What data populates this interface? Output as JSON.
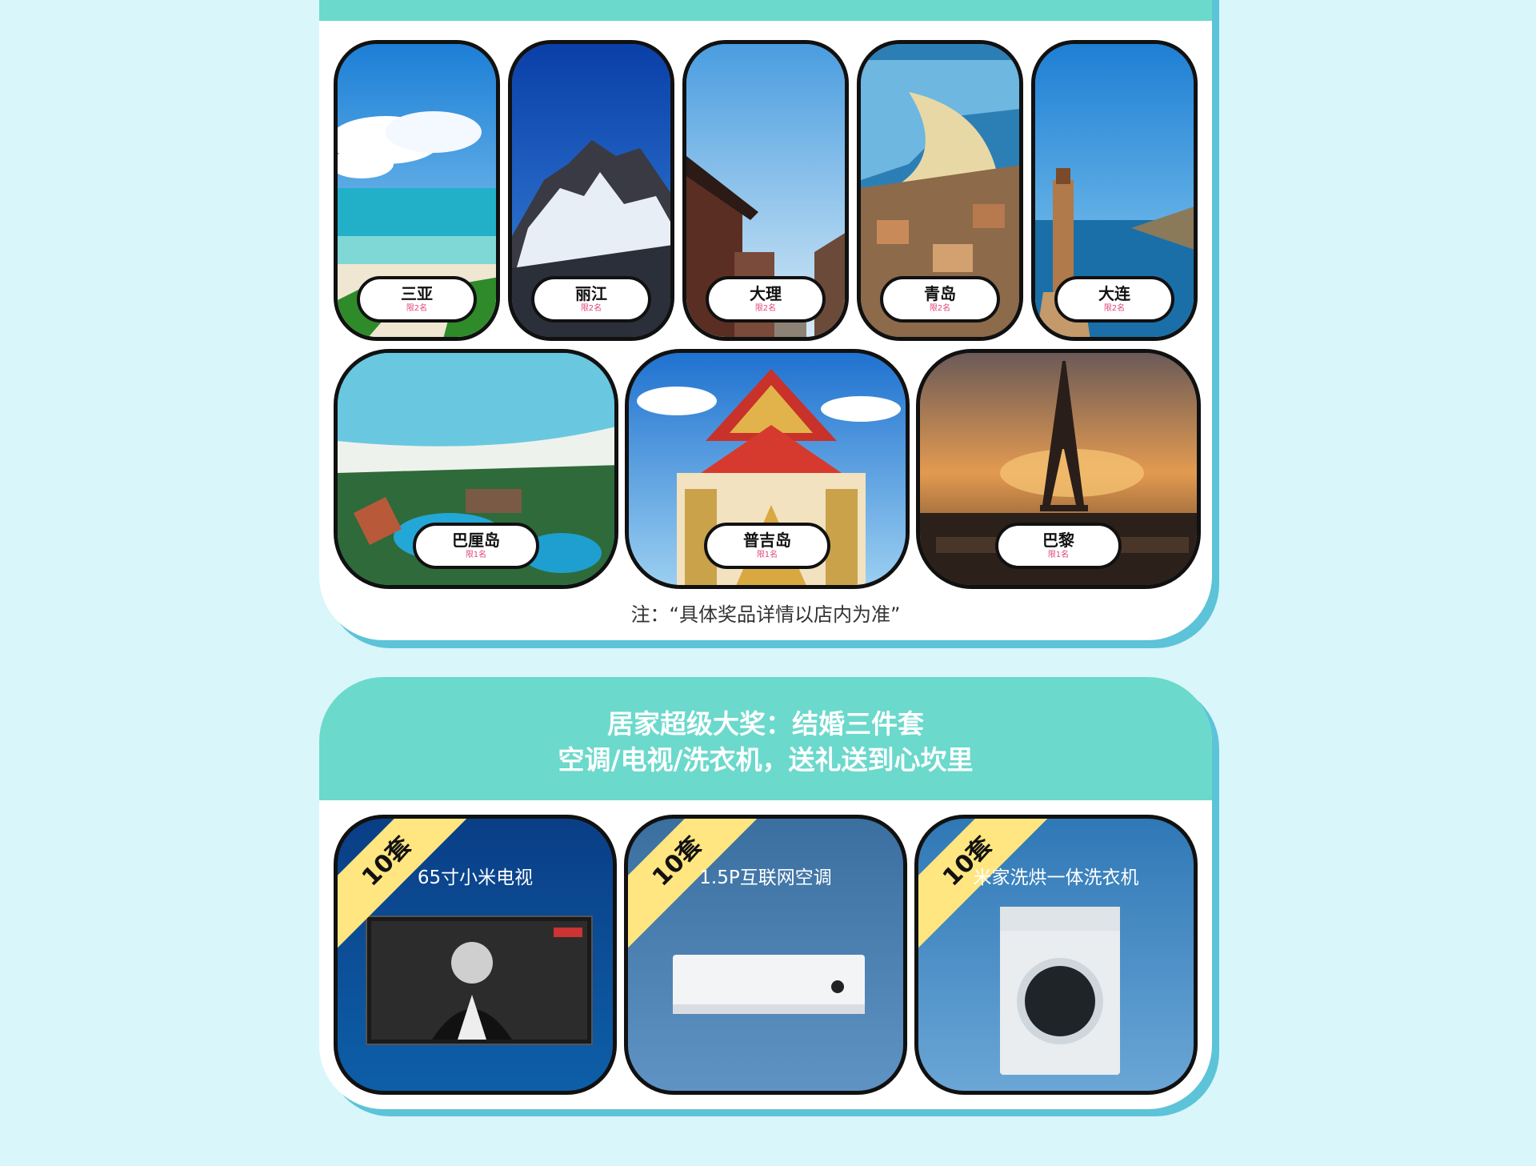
{
  "travel": {
    "destinations_row1": [
      {
        "name": "三亚",
        "quota": "限2名"
      },
      {
        "name": "丽江",
        "quota": "限2名"
      },
      {
        "name": "大理",
        "quota": "限2名"
      },
      {
        "name": "青岛",
        "quota": "限2名"
      },
      {
        "name": "大连",
        "quota": "限2名"
      }
    ],
    "destinations_row2": [
      {
        "name": "巴厘岛",
        "quota": "限1名"
      },
      {
        "name": "普吉岛",
        "quota": "限1名"
      },
      {
        "name": "巴黎",
        "quota": "限1名"
      }
    ],
    "note": "注：“具体奖品详情以店内为准”"
  },
  "home_prizes": {
    "title_line1": "居家超级大奖：结婚三件套",
    "title_line2": "空调/电视/洗衣机，送礼送到心坎里",
    "items": [
      {
        "badge": "10套",
        "title": "65寸小米电视"
      },
      {
        "badge": "10套",
        "title": "1.5P互联网空调"
      },
      {
        "badge": "10套",
        "title": "米家洗烘一体洗衣机"
      }
    ]
  },
  "colors": {
    "page_bg": "#d9f6fb",
    "teal": "#6bd9cc",
    "card_shadow": "#5cc3d8",
    "ribbon": "#ffe680",
    "quota_text": "#e0467c"
  }
}
